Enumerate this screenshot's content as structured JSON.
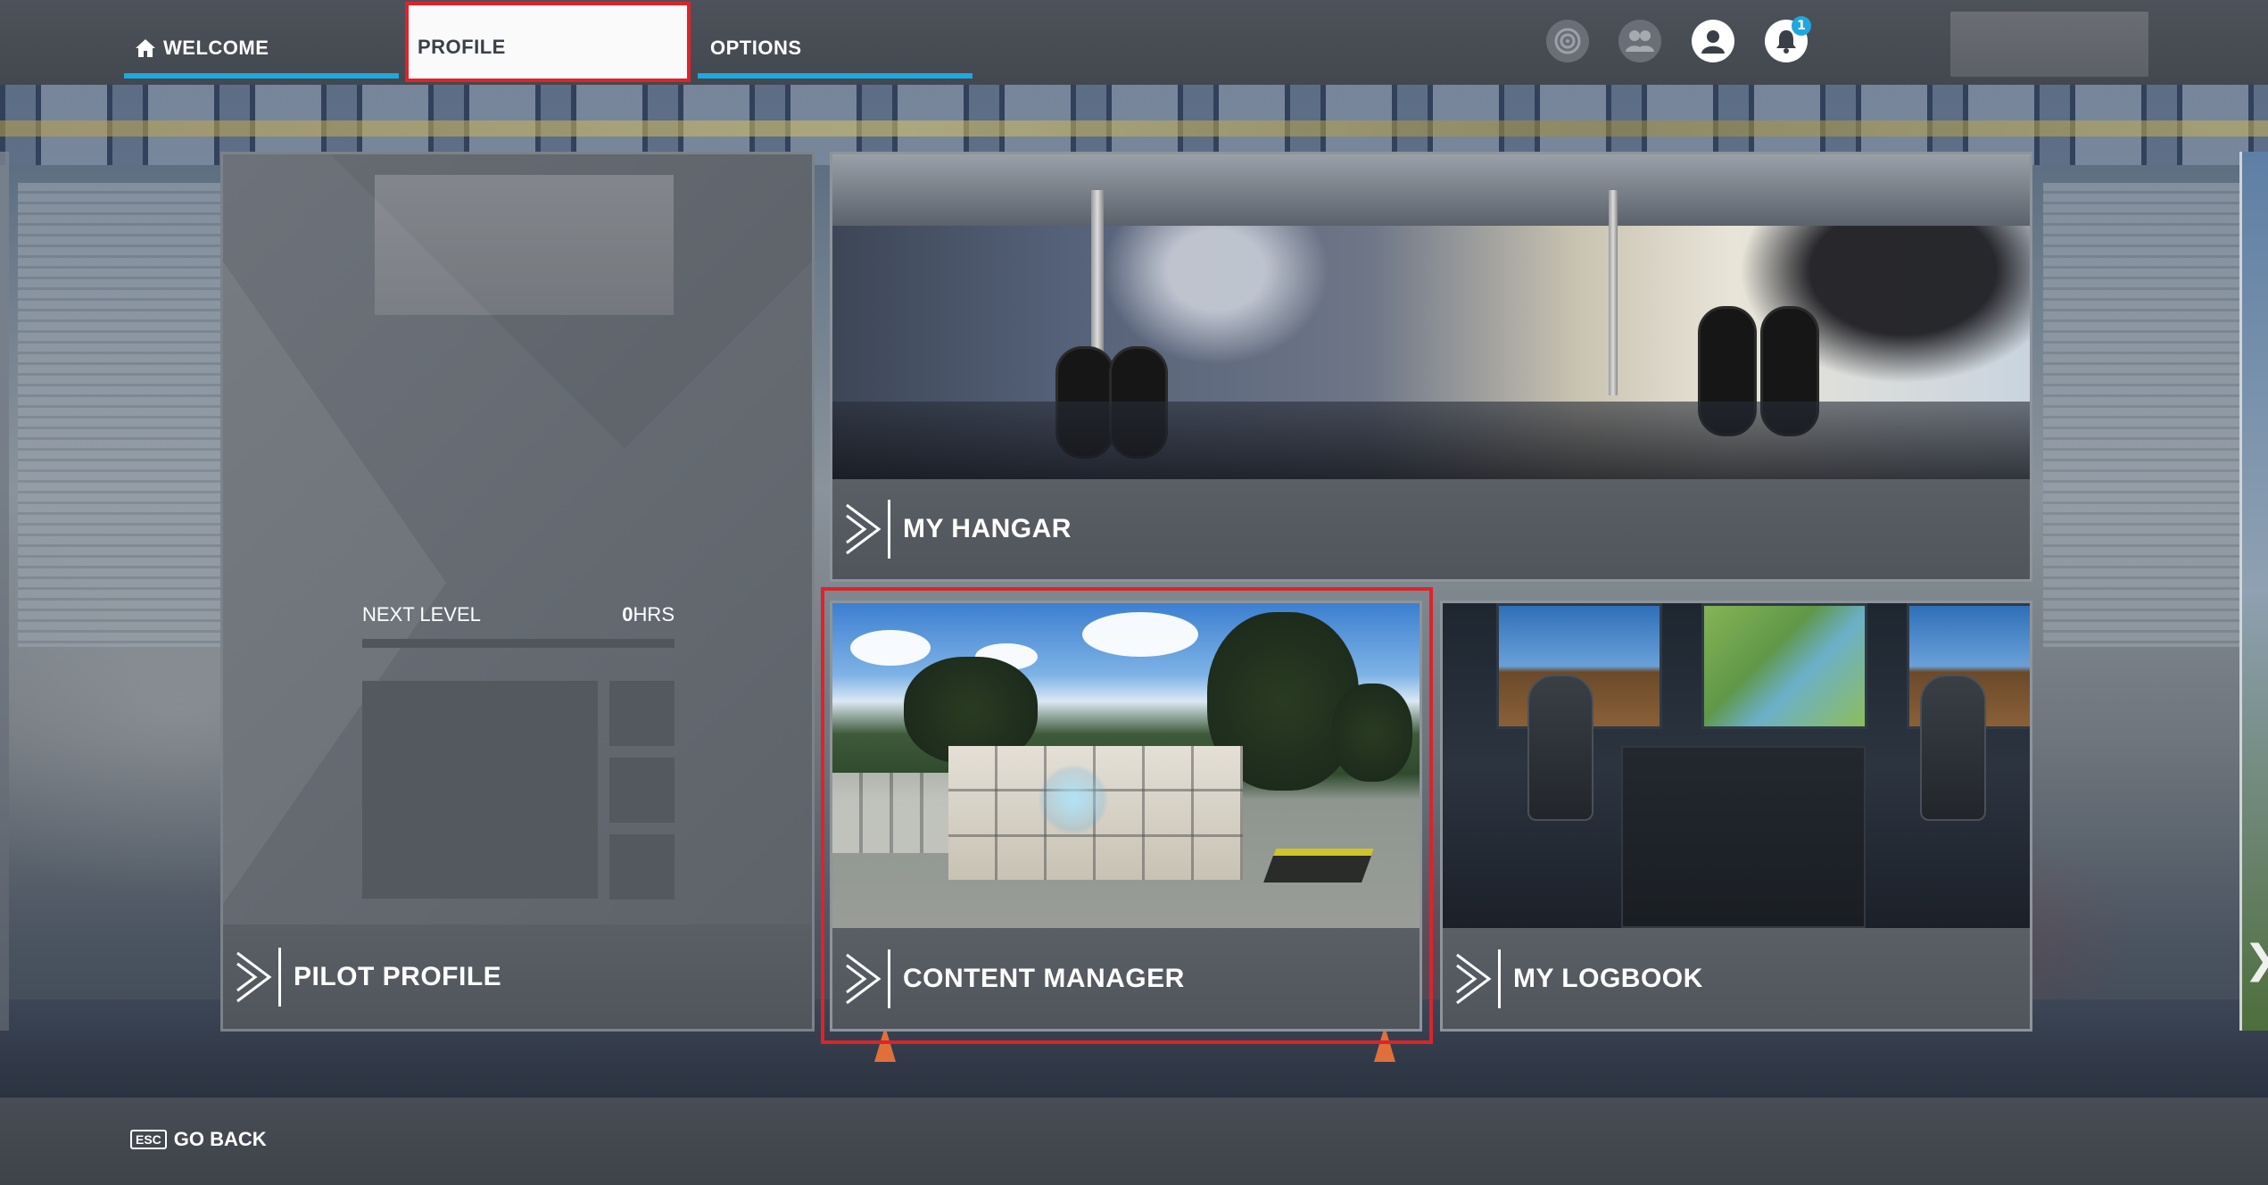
{
  "tabs": [
    {
      "label": "WELCOME",
      "icon": "home-icon",
      "active": false
    },
    {
      "label": "PROFILE",
      "active": true
    },
    {
      "label": "OPTIONS",
      "active": false
    }
  ],
  "header_icons": [
    {
      "name": "achievements-icon"
    },
    {
      "name": "friends-icon"
    },
    {
      "name": "profile-icon"
    },
    {
      "name": "notifications-icon",
      "badge": "1"
    }
  ],
  "pilot_card": {
    "next_level_label": "NEXT LEVEL",
    "hours_value": "0",
    "hours_unit": "HRS",
    "title": "PILOT PROFILE"
  },
  "cards": {
    "hangar": "MY HANGAR",
    "content": "CONTENT MANAGER",
    "logbook": "MY LOGBOOK"
  },
  "footer": {
    "esc_key": "ESC",
    "go_back": "GO BACK"
  },
  "colors": {
    "accent": "#1fa7df",
    "highlight": "#e0222a"
  }
}
